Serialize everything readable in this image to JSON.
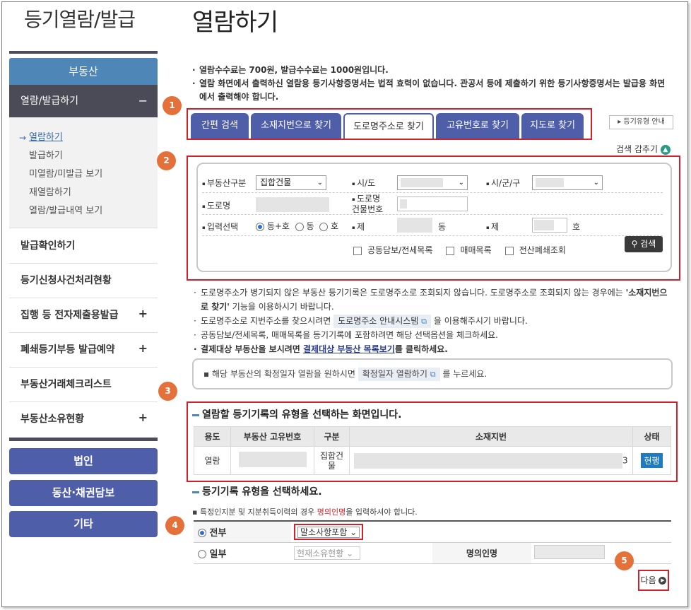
{
  "sidebar": {
    "title": "등기열람/발급",
    "realestate": "부동산",
    "active": "열람/발급하기",
    "active_toggle": "−",
    "sub_items": [
      "열람하기",
      "발급하기",
      "미열람/미발급 보기",
      "재열람하기",
      "열람/발급내역 보기"
    ],
    "items": [
      "발급확인하기",
      "등기신청사건처리현황",
      "집행 등 전자제출용발급",
      "폐쇄등기부등 발급예약",
      "부동산거래체크리스트",
      "부동산소유현황"
    ],
    "plus": "+",
    "buttons": [
      "법인",
      "동산·채권담보",
      "기타"
    ]
  },
  "main": {
    "title": "열람하기",
    "notices": [
      "열람수수료는 700원, 발급수수료는 1000원입니다.",
      "열람 화면에서 출력하신 열람용 등기사항증명서는 법적 효력이 없습니다. 관공서 등에 제출하기 위한 등기사항증명서는 발급용 화면에서 출력해야 합니다."
    ],
    "tabs": [
      "간편 검색",
      "소재지번으로 찾기",
      "도로명주소로 찾기",
      "고유번호로 찾기",
      "지도로 찾기"
    ],
    "guide_button": "등기유형 안내",
    "hide_search": "검색 감추기",
    "steps": [
      "1",
      "2",
      "3",
      "4",
      "5"
    ]
  },
  "search": {
    "type_label": "부동산구분",
    "type_value": "집합건물",
    "sido_label": "시/도",
    "sigungu_label": "시/군/구",
    "road_label": "도로명",
    "building_no_label": "도로명\n건물번호",
    "input_label": "입력선택",
    "radio_options": [
      "동+호",
      "동",
      "호"
    ],
    "je_label": "제",
    "dong_unit": "동",
    "ho_unit": "호",
    "checkboxes": [
      "공동담보/전세목록",
      "매매목록",
      "전산폐쇄조회"
    ],
    "search_button": "검색"
  },
  "info": {
    "line1_a": "도로명주소가 병기되지 않은 부동산 등기기록은 도로명주소로 조회되지 않습니다. 도로명주소로 조회되지 않는 경우에는 ",
    "line1_b": "'소재지번으로 찾기'",
    "line1_c": " 기능을 이용하시기 바랍니다.",
    "line2_a": "도로명주소로 지번주소를 찾으시려면",
    "line2_pill": "도로명주소 안내시스템",
    "line2_b": "을 이용해주시기 바랍니다.",
    "line3": "공동담보/전세목록, 매매목록을 등기기록에 포함하려면 해당 선택옵션을 체크하세요.",
    "line4_a": "결제대상 부동산을 보시려면 ",
    "line4_link": "결제대상 부동산 목록보기",
    "line4_b": "를 클릭하세요.",
    "confirm_a": "해당 부동산의 확정일자 열람을 원하시면",
    "confirm_pill": "확정일자 열람하기",
    "confirm_b": "를 누르세요."
  },
  "registry": {
    "heading": "열람할 등기기록의 유형을 선택하는 화면입니다.",
    "columns": [
      "용도",
      "부동산 고유번호",
      "구분",
      "소재지번",
      "상태"
    ],
    "row": {
      "use": "열람",
      "category": "집합건물",
      "address_tail": "3",
      "status": "현행"
    }
  },
  "type_select": {
    "heading": "등기기록 유형을 선택하세요.",
    "note_a": "특정인지분 및 지분취득이력의 경우 ",
    "note_red": "명의인명",
    "note_b": "을 입력하셔야 합니다.",
    "all_label": "전부",
    "all_value": "말소사항포함",
    "part_label": "일부",
    "part_value": "현재소유현황",
    "owner_label": "명의인명",
    "next_button": "다음"
  },
  "colors": {
    "accent": "#4f5ea8",
    "highlight": "#d0202a",
    "step": "#e4703a",
    "status": "#1f7bbf"
  }
}
